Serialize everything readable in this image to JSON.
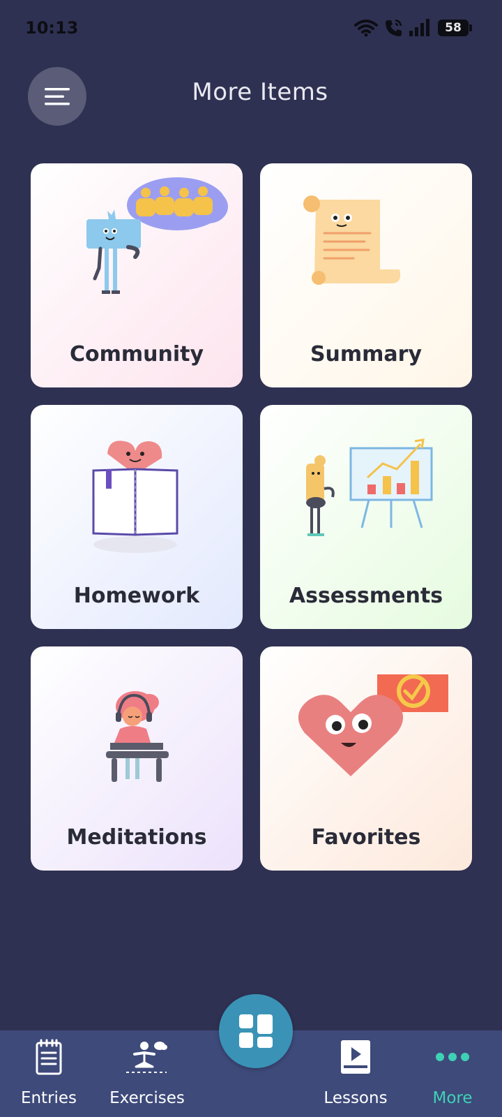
{
  "status_bar": {
    "time": "10:13",
    "battery": "58"
  },
  "header": {
    "title": "More Items"
  },
  "cards": [
    {
      "label": "Community"
    },
    {
      "label": "Summary"
    },
    {
      "label": "Homework"
    },
    {
      "label": "Assessments"
    },
    {
      "label": "Meditations"
    },
    {
      "label": "Favorites"
    }
  ],
  "bottom_nav": {
    "items": [
      {
        "label": "Entries",
        "icon": "notepad-icon"
      },
      {
        "label": "Exercises",
        "icon": "exercise-person-icon"
      },
      {
        "label": "Lessons",
        "icon": "video-lesson-icon"
      },
      {
        "label": "More",
        "icon": "more-dots-icon",
        "active": true
      }
    ],
    "center_button_icon": "grid-icon"
  },
  "colors": {
    "background": "#2f3152",
    "nav_background": "#3e4a7a",
    "active_accent": "#3fd1b6",
    "fab": "#3a93b6"
  }
}
